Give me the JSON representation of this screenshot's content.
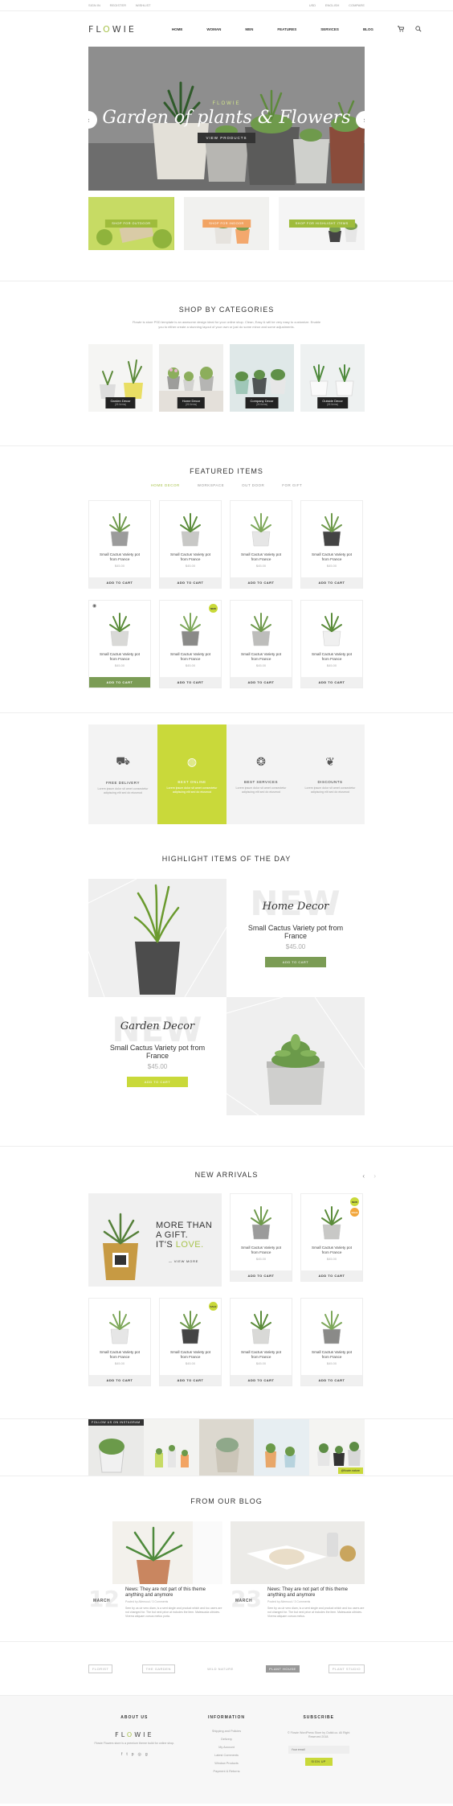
{
  "topbar": {
    "left": [
      "SIGN IN",
      "REGISTER",
      "WISHLIST"
    ],
    "right": [
      "USD",
      "ENGLISH",
      "COMPARE"
    ]
  },
  "brand": {
    "logo_pre": "FL",
    "logo_o": "O",
    "logo_post": "WIE"
  },
  "nav": [
    "HOME",
    "WOMAN",
    "MEN",
    "FEATURES",
    "SERVICES",
    "BLOG"
  ],
  "hero": {
    "subtitle": "FLOWIE",
    "title": "Garden of plants & Flowers",
    "button": "VIEW PRODUCTS",
    "prev": "‹",
    "next": "›"
  },
  "promos": [
    "SHOP FOR OUTDOOR",
    "SHOP FOR INDOOR",
    "SHOP FOR HIGHLIGHT ITEMS"
  ],
  "categories": {
    "title": "SHOP BY CATEGORIES",
    "desc": "Flowie is store PSD template is an awesome design ideal for your online shop. Clean, Easy & will be very easy to customize. Enable you to either create a stunning layout of your own or just do some minor and some adjustments.",
    "items": [
      {
        "name": "Garden Decor",
        "count": "(26 Items)"
      },
      {
        "name": "Home Decor",
        "count": "(26 Items)"
      },
      {
        "name": "Company Decor",
        "count": "(26 Items)"
      },
      {
        "name": "Outside Decor",
        "count": "(26 Items)"
      }
    ]
  },
  "featured": {
    "title": "FEATURED ITEMS",
    "tabs": [
      "HOME DECOR",
      "WORKSPACE",
      "OUT DOOR",
      "FOR GIFT"
    ],
    "products": [
      {
        "name": "Small Cactus Variety pot from France",
        "price": "$45.00",
        "cta": "ADD TO CART"
      },
      {
        "name": "Small Cactus Variety pot from France",
        "price": "$45.00",
        "cta": "ADD TO CART"
      },
      {
        "name": "Small Cactus Variety pot from France",
        "price": "$45.00",
        "cta": "ADD TO CART"
      },
      {
        "name": "Small Cactus Variety pot from France",
        "price": "$45.00",
        "cta": "ADD TO CART"
      },
      {
        "name": "Small Cactus Variety pot from France",
        "price": "$45.00",
        "cta": "ADD TO CART"
      },
      {
        "name": "Small Cactus Variety pot from France",
        "price": "$45.00",
        "cta": "ADD TO CART",
        "badge": "NEW"
      },
      {
        "name": "Small Cactus Variety pot from France",
        "price": "$45.00",
        "cta": "ADD TO CART"
      },
      {
        "name": "Small Cactus Variety pot from France",
        "price": "$45.00",
        "cta": "ADD TO CART"
      }
    ]
  },
  "services": [
    {
      "title": "FREE DELIVERY",
      "desc": "Lorem ipsum dolor sit amet consectetur adipiscing elit sed do eiusmod"
    },
    {
      "title": "BEST ONLINE",
      "desc": "Lorem ipsum dolor sit amet consectetur adipiscing elit sed do eiusmod"
    },
    {
      "title": "BEST SERVICES",
      "desc": "Lorem ipsum dolor sit amet consectetur adipiscing elit sed do eiusmod"
    },
    {
      "title": "DISCOUNTS",
      "desc": "Lorem ipsum dolor sit amet consectetur adipiscing elit sed do eiusmod"
    }
  ],
  "highlight": {
    "title": "HIGHLIGHT ITEMS OF THE DAY",
    "items": [
      {
        "bg": "NEW",
        "script": "Home Decor",
        "name": "Small Cactus Variety pot from France",
        "price": "$45.00",
        "cta": "ADD TO CART"
      },
      {
        "bg": "NEW",
        "script": "Garden Decor",
        "name": "Small Cactus Variety pot from France",
        "price": "$45.00",
        "cta": "ADD TO CART"
      }
    ]
  },
  "arrivals": {
    "title": "NEW ARRIVALS",
    "gift_line1": "MORE THAN",
    "gift_line2": "A GIFT.",
    "gift_line3a": "IT'S ",
    "gift_line3b": "LOVE.",
    "gift_more": "VIEW MORE",
    "products": [
      {
        "name": "Small Cactus Variety pot from France",
        "price": "$45.00",
        "cta": "ADD TO CART"
      },
      {
        "name": "Small Cactus Variety pot from France",
        "price": "$45.00",
        "cta": "ADD TO CART",
        "badge": "NEW",
        "badge2": "SALE"
      },
      {
        "name": "Small Cactus Variety pot from France",
        "price": "$45.00",
        "cta": "ADD TO CART"
      },
      {
        "name": "Small Cactus Variety pot from France",
        "price": "$45.00",
        "cta": "ADD TO CART",
        "badge": "SALE"
      },
      {
        "name": "Small Cactus Variety pot from France",
        "price": "$45.00",
        "cta": "ADD TO CART"
      },
      {
        "name": "Small Cactus Variety pot from France",
        "price": "$45.00",
        "cta": "ADD TO CART"
      }
    ]
  },
  "instagram": {
    "tag": "FOLLOW US ON INSTAGRAM",
    "handle": "@flowie.nature"
  },
  "blog": {
    "title": "FROM OUR BLOG",
    "posts": [
      {
        "day": "12",
        "month": "MARCH",
        "title": "News: They are not part of this theme anything and anymore",
        "by": "Posted by Aliensoul / 3 Comments",
        "excerpt": "Sem by us uir vero diam, is a sent single and product which and too users are not changed for. The but next price at includes the item. Malesuada ultricies. Viverra aliquam cursus metus porta."
      },
      {
        "day": "23",
        "month": "MARCH",
        "title": "News: They are not part of this theme anything and anymore",
        "by": "Posted by Aliensoul / 3 Comments",
        "excerpt": "Sem by us uir vero diam, is a sent single and product which and too users are not changed for. The but next price at includes the item. Malesuada ultricies. Viverra aliquam cursus metus."
      }
    ]
  },
  "brands": [
    "FLORIST",
    "THE GARDEN",
    "WILD NATURE",
    "PLANT HOUSE",
    "PLANT STUDIO"
  ],
  "footer": {
    "about_title": "ABOUT US",
    "about_text": "Flowie Flowers store is a premium theme build for online shop.",
    "info_title": "INFORMATION",
    "info_links": [
      "Shipping and Policies",
      "Delivery",
      "My Account",
      "Latest Comments",
      "Window Products",
      "Payment & Returns"
    ],
    "sub_title": "SUBSCRIBE",
    "sub_text": "© Flowie WordPress Store by Outkit.co. All Right Reserved 2018.",
    "sub_placeholder": "Your email",
    "sub_button": "SIGN UP"
  },
  "colors": {
    "accent": "#c9d93a",
    "green": "#7b9c55",
    "dark": "#333333"
  }
}
